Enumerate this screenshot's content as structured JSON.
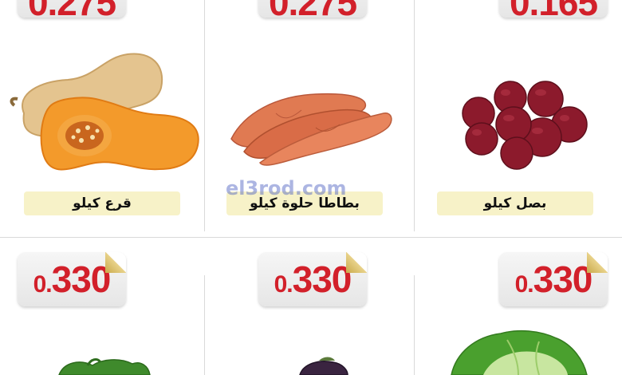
{
  "top_row": [
    {
      "product": "قرع كيلو",
      "price_visible": "0.275"
    },
    {
      "product": "بطاطا حلوة كيلو",
      "price_visible": "0.275"
    },
    {
      "product": "بصل كيلو",
      "price_visible": "0.165"
    }
  ],
  "bottom_row": [
    {
      "price_prefix": "0.",
      "price_main": "330"
    },
    {
      "price_prefix": "0.",
      "price_main": "330"
    },
    {
      "price_prefix": "0.",
      "price_main": "330"
    }
  ],
  "watermark": "el3rod.com",
  "colors": {
    "price": "#d2202a",
    "label_bg": "#f7f2c8",
    "tag_bg": "#eeeeee"
  }
}
